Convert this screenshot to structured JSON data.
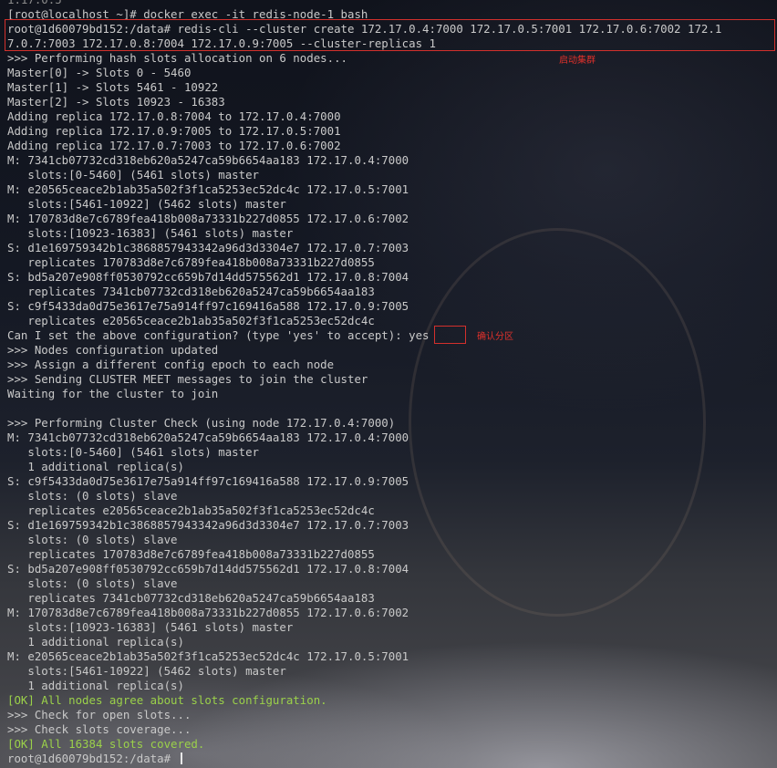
{
  "terminal": {
    "lines": [
      "1.17.0.5",
      "[root@localhost ~]# docker exec -it redis-node-1 bash",
      "root@1d60079bd152:/data# redis-cli --cluster create 172.17.0.4:7000 172.17.0.5:7001 172.17.0.6:7002 172.1",
      "7.0.7:7003 172.17.0.8:7004 172.17.0.9:7005 --cluster-replicas 1",
      ">>> Performing hash slots allocation on 6 nodes...",
      "Master[0] -> Slots 0 - 5460",
      "Master[1] -> Slots 5461 - 10922",
      "Master[2] -> Slots 10923 - 16383",
      "Adding replica 172.17.0.8:7004 to 172.17.0.4:7000",
      "Adding replica 172.17.0.9:7005 to 172.17.0.5:7001",
      "Adding replica 172.17.0.7:7003 to 172.17.0.6:7002",
      "M: 7341cb07732cd318eb620a5247ca59b6654aa183 172.17.0.4:7000",
      "   slots:[0-5460] (5461 slots) master",
      "M: e20565ceace2b1ab35a502f3f1ca5253ec52dc4c 172.17.0.5:7001",
      "   slots:[5461-10922] (5462 slots) master",
      "M: 170783d8e7c6789fea418b008a73331b227d0855 172.17.0.6:7002",
      "   slots:[10923-16383] (5461 slots) master",
      "S: d1e169759342b1c3868857943342a96d3d3304e7 172.17.0.7:7003",
      "   replicates 170783d8e7c6789fea418b008a73331b227d0855",
      "S: bd5a207e908ff0530792cc659b7d14dd575562d1 172.17.0.8:7004",
      "   replicates 7341cb07732cd318eb620a5247ca59b6654aa183",
      "S: c9f5433da0d75e3617e75a914ff97c169416a588 172.17.0.9:7005",
      "   replicates e20565ceace2b1ab35a502f3f1ca5253ec52dc4c",
      "Can I set the above configuration? (type 'yes' to accept): yes",
      ">>> Nodes configuration updated",
      ">>> Assign a different config epoch to each node",
      ">>> Sending CLUSTER MEET messages to join the cluster",
      "Waiting for the cluster to join",
      "",
      ">>> Performing Cluster Check (using node 172.17.0.4:7000)",
      "M: 7341cb07732cd318eb620a5247ca59b6654aa183 172.17.0.4:7000",
      "   slots:[0-5460] (5461 slots) master",
      "   1 additional replica(s)",
      "S: c9f5433da0d75e3617e75a914ff97c169416a588 172.17.0.9:7005",
      "   slots: (0 slots) slave",
      "   replicates e20565ceace2b1ab35a502f3f1ca5253ec52dc4c",
      "S: d1e169759342b1c3868857943342a96d3d3304e7 172.17.0.7:7003",
      "   slots: (0 slots) slave",
      "   replicates 170783d8e7c6789fea418b008a73331b227d0855",
      "S: bd5a207e908ff0530792cc659b7d14dd575562d1 172.17.0.8:7004",
      "   slots: (0 slots) slave",
      "   replicates 7341cb07732cd318eb620a5247ca59b6654aa183",
      "M: 170783d8e7c6789fea418b008a73331b227d0855 172.17.0.6:7002",
      "   slots:[10923-16383] (5461 slots) master",
      "   1 additional replica(s)",
      "M: e20565ceace2b1ab35a502f3f1ca5253ec52dc4c 172.17.0.5:7001",
      "   slots:[5461-10922] (5462 slots) master",
      "   1 additional replica(s)",
      "[OK] All nodes agree about slots configuration.",
      ">>> Check for open slots...",
      ">>> Check slots coverage...",
      "[OK] All 16384 slots covered.",
      "root@1d60079bd152:/data# "
    ],
    "ok_color": "#9bd14a",
    "text_color": "#c9c9c9"
  },
  "annotations": {
    "start_cluster": "启动集群",
    "confirm_partition": "确认分区",
    "color": "#d3302c"
  }
}
